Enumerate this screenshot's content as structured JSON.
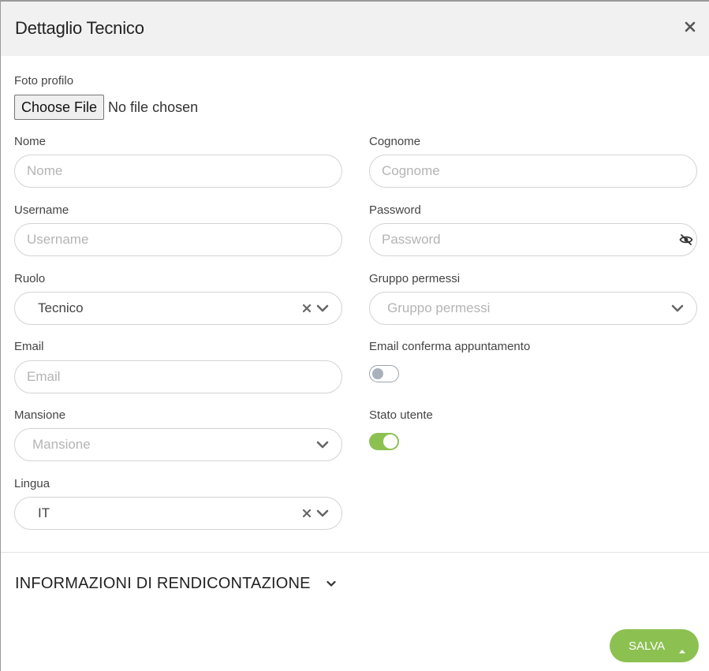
{
  "dialog": {
    "title": "Dettaglio Tecnico",
    "close_icon": "close-icon"
  },
  "photo": {
    "label": "Foto profilo",
    "button": "Choose File",
    "status": "No file chosen"
  },
  "fields": {
    "nome": {
      "label": "Nome",
      "placeholder": "Nome",
      "value": ""
    },
    "cognome": {
      "label": "Cognome",
      "placeholder": "Cognome",
      "value": ""
    },
    "username": {
      "label": "Username",
      "placeholder": "Username",
      "value": ""
    },
    "password": {
      "label": "Password",
      "placeholder": "Password",
      "value": "",
      "icon": "eye-slash-icon"
    },
    "ruolo": {
      "label": "Ruolo",
      "value": "Tecnico",
      "icons": [
        "clear-icon",
        "chevron-down-icon"
      ]
    },
    "gruppo": {
      "label": "Gruppo permessi",
      "placeholder": "Gruppo permessi",
      "value": "",
      "icons": [
        "chevron-down-icon"
      ]
    },
    "email": {
      "label": "Email",
      "placeholder": "Email",
      "value": ""
    },
    "email_conferma": {
      "label": "Email conferma appuntamento",
      "checked": false
    },
    "mansione": {
      "label": "Mansione",
      "placeholder": "Mansione",
      "value": "",
      "icons": [
        "chevron-down-icon"
      ]
    },
    "stato": {
      "label": "Stato utente",
      "checked": true
    },
    "lingua": {
      "label": "Lingua",
      "value": "IT",
      "icons": [
        "clear-icon",
        "chevron-down-icon"
      ]
    }
  },
  "section": {
    "title": "INFORMAZIONI DI RENDICONTAZIONE",
    "icon": "chevron-down-icon"
  },
  "footer": {
    "save_label": "SALVA",
    "save_icon": "caret-up-icon"
  },
  "colors": {
    "accent": "#8cc152",
    "header_bg": "#f1f1f1",
    "border": "#d3d3d3",
    "placeholder": "#b4b4b4"
  }
}
